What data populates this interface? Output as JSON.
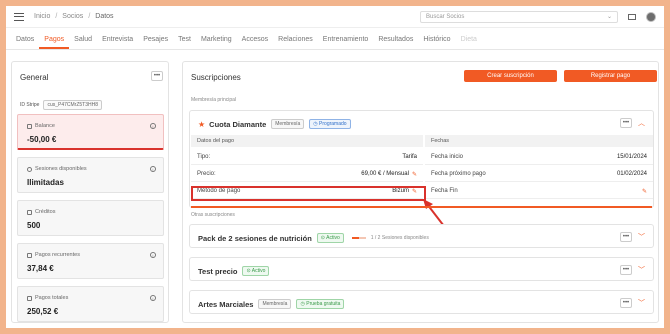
{
  "breadcrumb": [
    "Inicio",
    "Socios",
    "Datos"
  ],
  "search": {
    "placeholder": "Buscar Socios"
  },
  "tabs": [
    {
      "label": "Datos",
      "state": "normal"
    },
    {
      "label": "Pagos",
      "state": "active"
    },
    {
      "label": "Salud",
      "state": "normal"
    },
    {
      "label": "Entrevista",
      "state": "normal"
    },
    {
      "label": "Pesajes",
      "state": "normal"
    },
    {
      "label": "Test",
      "state": "normal"
    },
    {
      "label": "Marketing",
      "state": "normal"
    },
    {
      "label": "Accesos",
      "state": "normal"
    },
    {
      "label": "Relaciones",
      "state": "normal"
    },
    {
      "label": "Entrenamiento",
      "state": "normal"
    },
    {
      "label": "Resultados",
      "state": "normal"
    },
    {
      "label": "Histórico",
      "state": "normal"
    },
    {
      "label": "Dieta",
      "state": "disabled"
    }
  ],
  "general": {
    "title": "General",
    "id_label": "ID Stripe",
    "id_value": "cus_P47CMrZ5T3HH8",
    "stats": [
      {
        "label": "Balance",
        "value": "-50,00 €",
        "highlight": true,
        "info": true
      },
      {
        "label": "Sesiones disponibles",
        "value": "Ilimitadas",
        "highlight": false,
        "info": true
      },
      {
        "label": "Créditos",
        "value": "500",
        "highlight": false,
        "info": false
      },
      {
        "label": "Pagos recurrentes",
        "value": "37,84 €",
        "highlight": false,
        "info": true
      },
      {
        "label": "Pagos totales",
        "value": "250,52 €",
        "highlight": false,
        "info": true
      }
    ]
  },
  "suscripciones": {
    "title": "Suscripciones",
    "create_button": "Crear suscripción",
    "register_button": "Registrar pago",
    "main_label": "Membresía principal",
    "other_label": "Otras suscripciones",
    "main_card": {
      "title": "Cuota Diamante",
      "badge_type": "Membresía",
      "badge_status": "Programado",
      "payment_header": "Datos del pago",
      "dates_header": "Fechas",
      "rows_left": [
        {
          "label": "Tipo:",
          "value": "Tarifa",
          "editable": false
        },
        {
          "label": "Precio:",
          "value": "69,00 € / Mensual",
          "editable": true
        },
        {
          "label": "Método de pago",
          "value": "Bizum",
          "editable": true
        }
      ],
      "rows_right": [
        {
          "label": "Fecha inicio",
          "value": "15/01/2024",
          "editable": false
        },
        {
          "label": "Fecha próximo pago",
          "value": "01/02/2024",
          "editable": false
        },
        {
          "label": "Fecha Fin",
          "value": "",
          "editable": true
        }
      ]
    },
    "other_cards": [
      {
        "title": "Pack de 2 sesiones de nutrición",
        "badges": [
          {
            "text": "Activo",
            "style": "green"
          }
        ],
        "progress_text": "1 / 2 Sesiones disponibles",
        "progress": 0.5
      },
      {
        "title": "Test precio",
        "badges": [
          {
            "text": "Activo",
            "style": "green"
          }
        ]
      },
      {
        "title": "Artes Marciales",
        "badges": [
          {
            "text": "Membresía",
            "style": "gray"
          },
          {
            "text": "Prueba gratuita",
            "style": "green"
          }
        ]
      }
    ]
  },
  "colors": {
    "accent": "#f15a24",
    "danger": "#d9322c",
    "frame": "#f2b48c"
  }
}
